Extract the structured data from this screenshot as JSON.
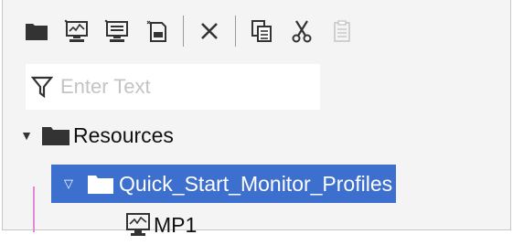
{
  "toolbar": {
    "buttons": [
      {
        "name": "new-folder",
        "icon": "folder-icon"
      },
      {
        "name": "new-monitor-profile",
        "icon": "monitor-star-icon"
      },
      {
        "name": "new-monitor-profile-2",
        "icon": "monitor-list-icon"
      },
      {
        "name": "new-template",
        "icon": "document-star-icon"
      },
      {
        "name": "delete",
        "icon": "close-icon"
      },
      {
        "name": "copy",
        "icon": "copy-icon"
      },
      {
        "name": "cut",
        "icon": "scissors-icon"
      },
      {
        "name": "paste",
        "icon": "clipboard-icon",
        "disabled": true
      }
    ]
  },
  "filter": {
    "placeholder": "Enter Text",
    "value": ""
  },
  "tree": {
    "root": {
      "label": "Resources",
      "expanded": true
    },
    "folder": {
      "label": "Quick_Start_Monitor_Profiles",
      "expanded": true,
      "selected": true
    },
    "item": {
      "label": "MP1"
    }
  },
  "colors": {
    "selection": "#3d6fcf",
    "icon": "#3a3a3a",
    "disabled": "#c6c6c6"
  }
}
